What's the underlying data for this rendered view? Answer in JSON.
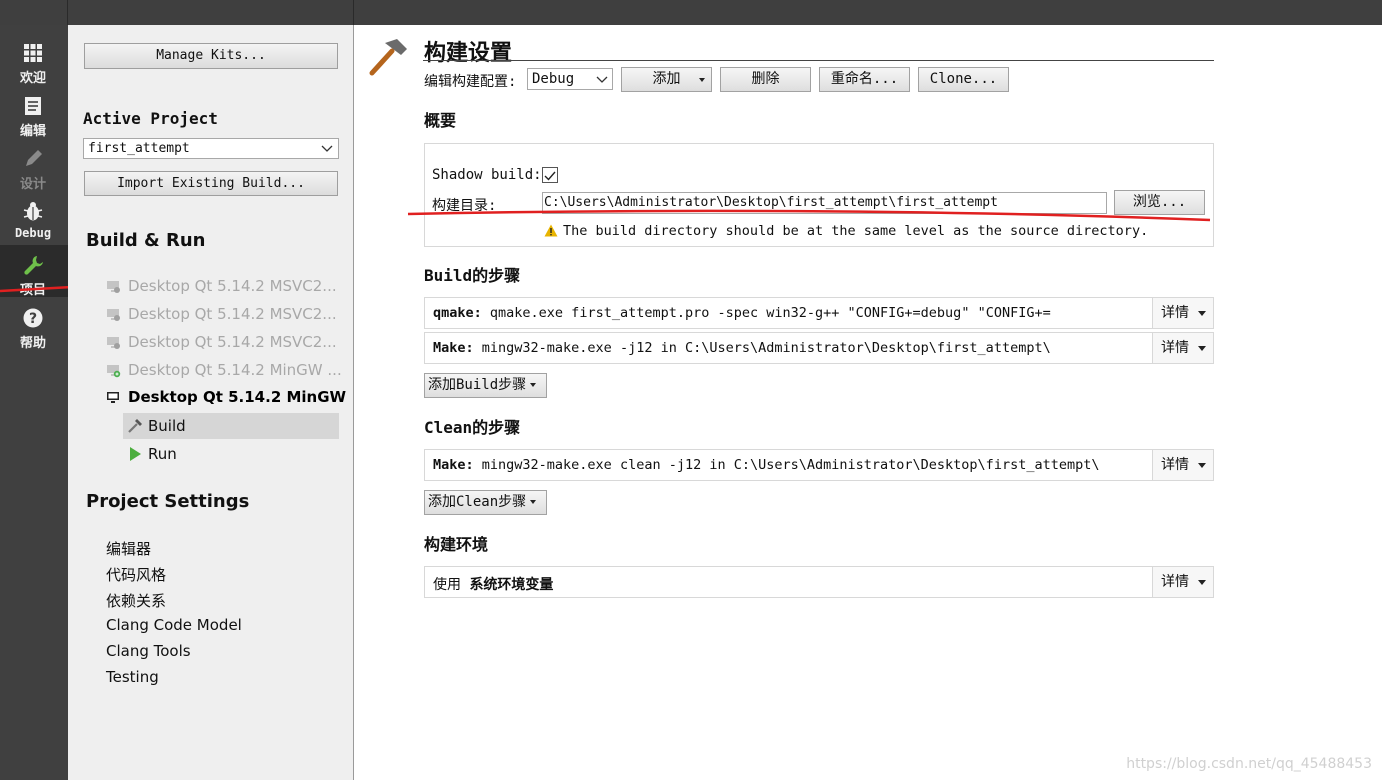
{
  "modebar": {
    "items": [
      {
        "label": "欢迎",
        "icon": "grid-icon"
      },
      {
        "label": "编辑",
        "icon": "document-icon"
      },
      {
        "label": "设计",
        "icon": "pencil-icon"
      },
      {
        "label": "Debug",
        "icon": "bug-icon"
      },
      {
        "label": "项目",
        "icon": "wrench-icon"
      },
      {
        "label": "帮助",
        "icon": "help-icon"
      }
    ]
  },
  "nav": {
    "manage_kits": "Manage Kits...",
    "active_project_label": "Active Project",
    "active_project_value": "first_attempt",
    "import_build": "Import Existing Build...",
    "build_run_title": "Build & Run",
    "kits": [
      "Desktop Qt 5.14.2 MSVC2...",
      "Desktop Qt 5.14.2 MSVC2...",
      "Desktop Qt 5.14.2 MSVC2...",
      "Desktop Qt 5.14.2 MinGW ...",
      "Desktop Qt 5.14.2 MinGW..."
    ],
    "sub_build": "Build",
    "sub_run": "Run",
    "project_settings_title": "Project Settings",
    "settings": [
      "编辑器",
      "代码风格",
      "依赖关系",
      "Clang Code Model",
      "Clang Tools",
      "Testing"
    ]
  },
  "main": {
    "title": "构建设置",
    "edit_config_label": "编辑构建配置:",
    "config_value": "Debug",
    "add_label": "添加",
    "delete_label": "删除",
    "rename_label": "重命名...",
    "clone_label": "Clone...",
    "overview_heading": "概要",
    "shadow_build_label": "Shadow build:",
    "shadow_build_checked": true,
    "build_dir_label": "构建目录:",
    "build_dir_value": "C:\\Users\\Administrator\\Desktop\\first_attempt\\first_attempt",
    "browse_label": "浏览...",
    "warning_text": "The build directory should be at the same level as the source directory.",
    "build_steps_heading": "Build的步骤",
    "build_steps": [
      {
        "prefix": "qmake:",
        "text": " qmake.exe first_attempt.pro -spec win32-g++ \"CONFIG+=debug\" \"CONFIG+="
      },
      {
        "prefix": "Make:",
        "text": " mingw32-make.exe -j12 in C:\\Users\\Administrator\\Desktop\\first_attempt\\"
      }
    ],
    "add_build_step": "添加Build步骤",
    "clean_steps_heading": "Clean的步骤",
    "clean_steps": [
      {
        "prefix": "Make:",
        "text": " mingw32-make.exe clean -j12 in C:\\Users\\Administrator\\Desktop\\first_attempt\\"
      }
    ],
    "add_clean_step": "添加Clean步骤",
    "env_heading": "构建环境",
    "env_use": "使用",
    "env_value": "系统环境变量",
    "details_label": "详情"
  },
  "watermark": "https://blog.csdn.net/qq_45488453",
  "colors": {
    "modebar_bg": "#404040",
    "annotation_red": "#e02020",
    "warning_yellow": "#e8b400"
  }
}
